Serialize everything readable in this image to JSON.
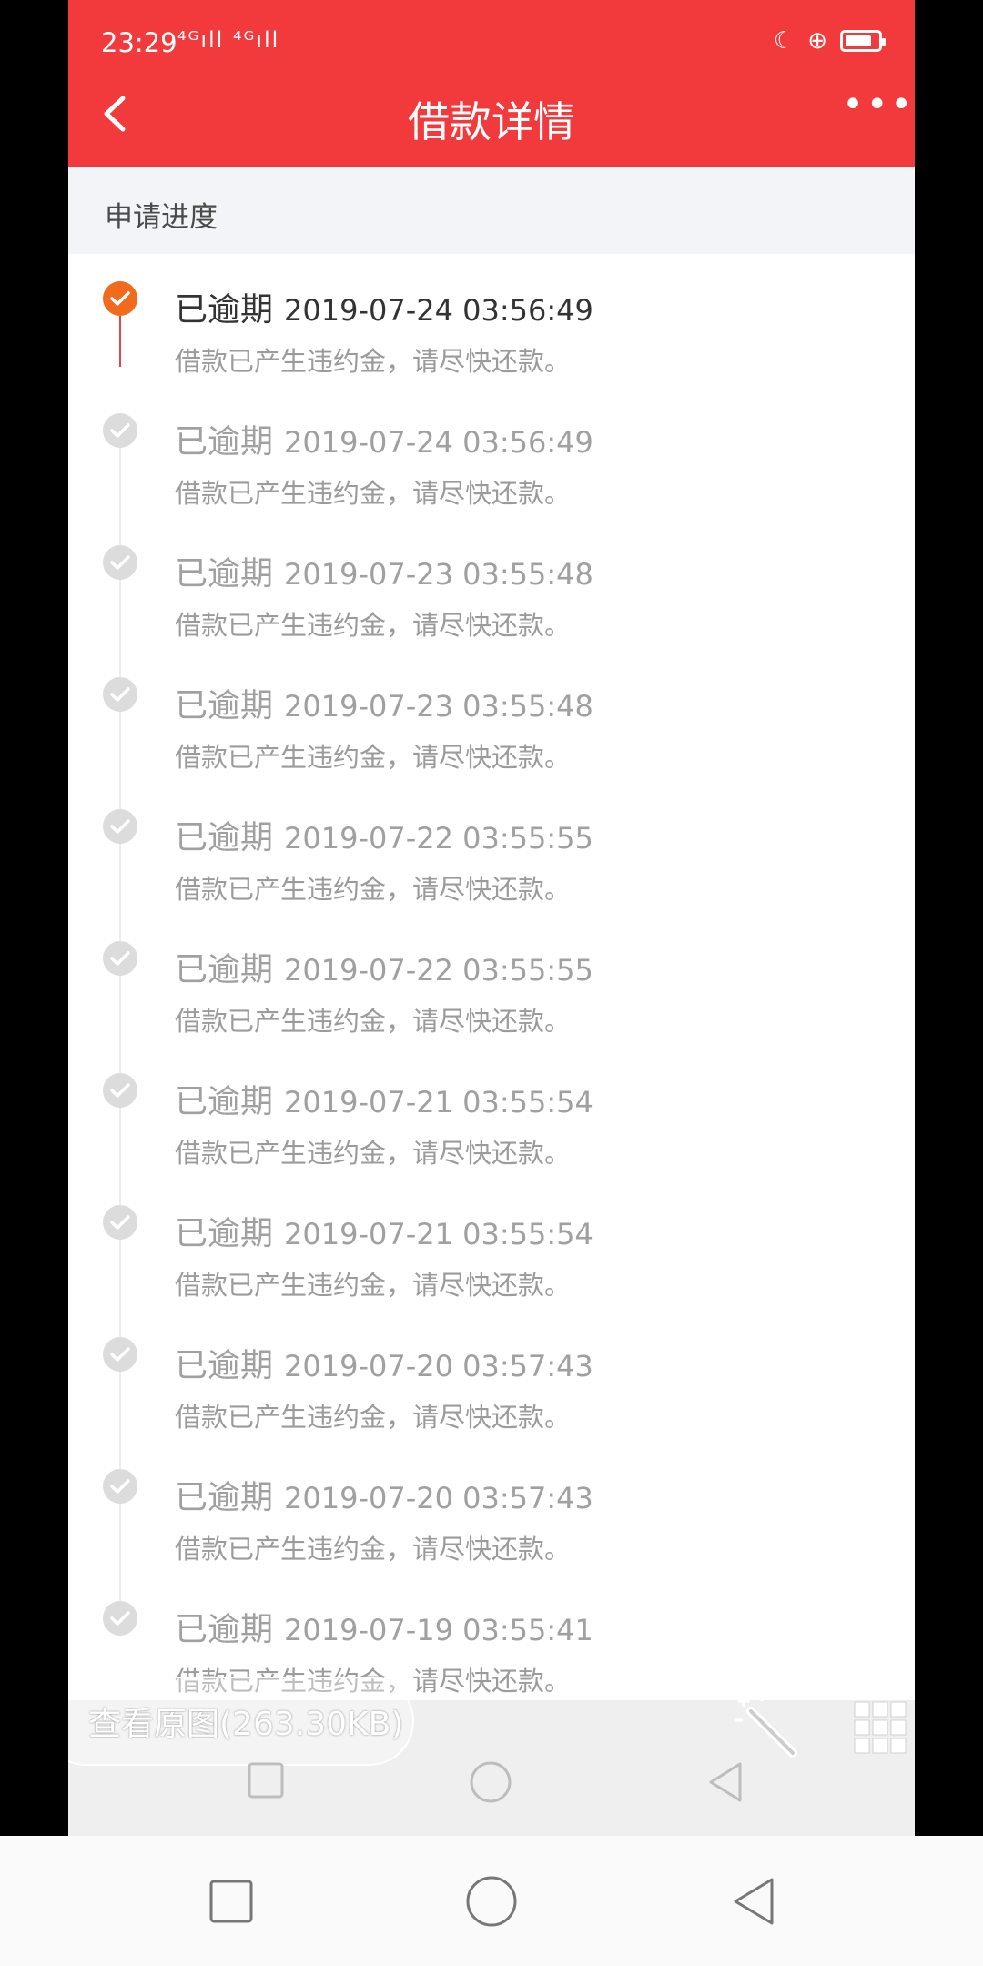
{
  "status_bar": {
    "time": "23:29",
    "signal": "⁴ᴳıll ⁴ᴳıll",
    "icons": [
      "moon-icon",
      "lock-rotate-icon",
      "battery-icon",
      "wifi-icon"
    ]
  },
  "header": {
    "title": "借款详情",
    "more": "•••",
    "back_icon": "chevron-left-icon"
  },
  "section": {
    "title": "申请进度"
  },
  "timeline": [
    {
      "status": "已逾期",
      "time": "2019-07-24 03:56:49",
      "desc": "借款已产生违约金，请尽快还款。",
      "active": true
    },
    {
      "status": "已逾期",
      "time": "2019-07-24 03:56:49",
      "desc": "借款已产生违约金，请尽快还款。",
      "active": false
    },
    {
      "status": "已逾期",
      "time": "2019-07-23 03:55:48",
      "desc": "借款已产生违约金，请尽快还款。",
      "active": false
    },
    {
      "status": "已逾期",
      "time": "2019-07-23 03:55:48",
      "desc": "借款已产生违约金，请尽快还款。",
      "active": false
    },
    {
      "status": "已逾期",
      "time": "2019-07-22 03:55:55",
      "desc": "借款已产生违约金，请尽快还款。",
      "active": false
    },
    {
      "status": "已逾期",
      "time": "2019-07-22 03:55:55",
      "desc": "借款已产生违约金，请尽快还款。",
      "active": false
    },
    {
      "status": "已逾期",
      "time": "2019-07-21 03:55:54",
      "desc": "借款已产生违约金，请尽快还款。",
      "active": false
    },
    {
      "status": "已逾期",
      "time": "2019-07-21 03:55:54",
      "desc": "借款已产生违约金，请尽快还款。",
      "active": false
    },
    {
      "status": "已逾期",
      "time": "2019-07-20 03:57:43",
      "desc": "借款已产生违约金，请尽快还款。",
      "active": false
    },
    {
      "status": "已逾期",
      "time": "2019-07-20 03:57:43",
      "desc": "借款已产生违约金，请尽快还款。",
      "active": false
    },
    {
      "status": "已逾期",
      "time": "2019-07-19 03:55:41",
      "desc": "借款已产生违约金，请尽快还款。",
      "active": false
    }
  ],
  "overlay": {
    "view_original": "查看原图(263.30KB)"
  },
  "colors": {
    "header_bg": "#f23a3d",
    "active_dot": "#f26b1d",
    "inactive_dot": "#dcdcdc",
    "section_bg": "#f2f4f7"
  }
}
